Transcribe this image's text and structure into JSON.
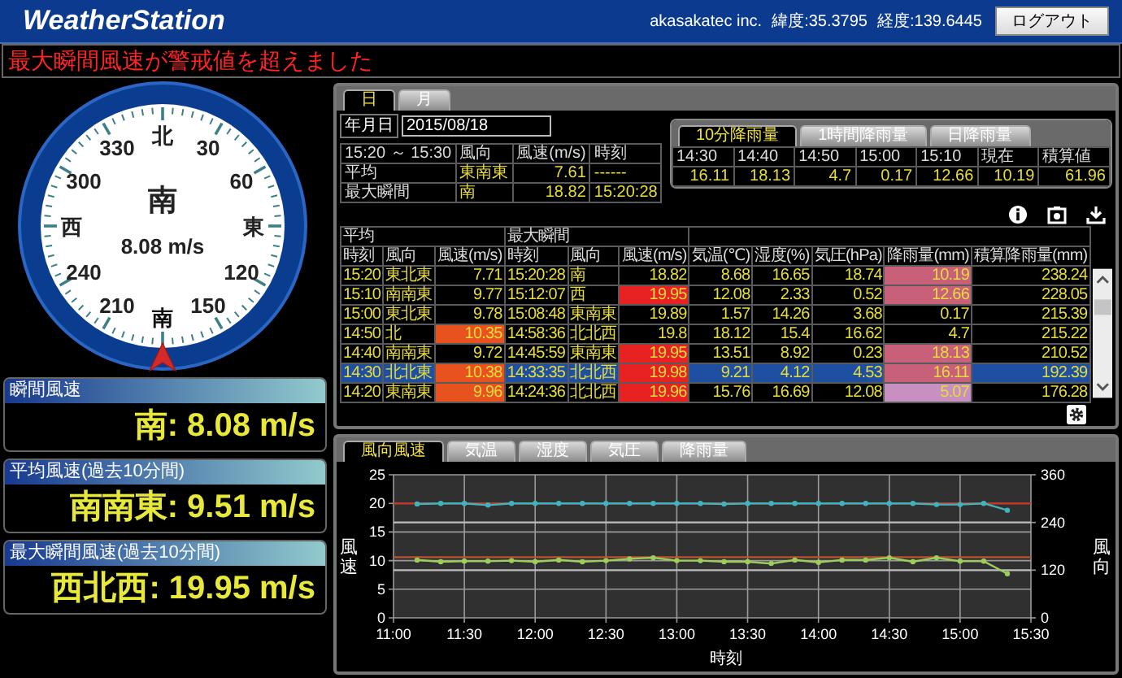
{
  "header": {
    "title": "WeatherStation",
    "company": "akasakatec inc.",
    "latitude": "緯度:35.3795",
    "longitude": "経度:139.6445",
    "logout_button": "ログアウト"
  },
  "alert": "最大瞬間風速が警戒値を超えました",
  "compass": {
    "dial_labels": [
      {
        "text": "北",
        "selected": false
      },
      {
        "text": "330",
        "selected": false
      },
      {
        "text": "30",
        "selected": false
      },
      {
        "text": "300",
        "selected": false
      },
      {
        "text": "60",
        "selected": false
      },
      {
        "text": "西",
        "selected": false
      },
      {
        "text": "東",
        "selected": false
      },
      {
        "text": "240",
        "selected": false
      },
      {
        "text": "120",
        "selected": false
      },
      {
        "text": "210",
        "selected": false
      },
      {
        "text": "150",
        "selected": false
      },
      {
        "text": "南",
        "selected": true
      }
    ],
    "direction": "南",
    "speed": "8.08 m/s"
  },
  "wind_panels": [
    {
      "title": "瞬間風速",
      "value": "南: 8.08 m/s"
    },
    {
      "title": "平均風速(過去10分間)",
      "value": "南南東: 9.51 m/s"
    },
    {
      "title": "最大瞬間風速(過去10分間)",
      "value": "西北西: 19.95 m/s"
    }
  ],
  "period_tabs": [
    {
      "label": "日",
      "selected": true
    },
    {
      "label": "月",
      "selected": false
    }
  ],
  "date": {
    "label": "年月日",
    "value": "2015/08/18"
  },
  "summary": {
    "columns": [
      "15:20 ～ 15:30",
      "風向",
      "風速(m/s)",
      "時刻"
    ],
    "rows": [
      [
        "平均",
        "東南東",
        "7.61",
        "------"
      ],
      [
        "最大瞬間",
        "南",
        "18.82",
        "15:20:28"
      ]
    ]
  },
  "rain": {
    "tabs": [
      {
        "label": "10分降雨量",
        "selected": true
      },
      {
        "label": "1時間降雨量",
        "selected": false
      },
      {
        "label": "日降雨量",
        "selected": false
      }
    ],
    "columns": [
      "14:30",
      "14:40",
      "14:50",
      "15:00",
      "15:10",
      "現在",
      "積算値"
    ],
    "values": [
      "16.11",
      "18.13",
      "4.7",
      "0.17",
      "12.66",
      "10.19",
      "61.96"
    ]
  },
  "table": {
    "groups": [
      {
        "label": "平均",
        "columns": [
          "時刻",
          "風向",
          "風速(m/s)"
        ]
      },
      {
        "label": "最大瞬間",
        "columns": [
          "時刻",
          "風向",
          "風速(m/s)"
        ]
      },
      {
        "columns": [
          "気温(℃)",
          "湿度(%)",
          "気圧(hPa)",
          "降雨量(mm)",
          "積算降雨量(mm)"
        ]
      }
    ],
    "rows": [
      {
        "selected": false,
        "cells": [
          {
            "text": "15:20"
          },
          {
            "text": "東北東"
          },
          {
            "text": "7.71"
          },
          {
            "text": "15:20:28"
          },
          {
            "text": "南"
          },
          {
            "text": "18.82"
          },
          {
            "text": "8.68"
          },
          {
            "text": "16.65"
          },
          {
            "text": "18.74"
          },
          {
            "text": "10.19",
            "color": "#c8607a"
          },
          {
            "text": "238.24"
          }
        ]
      },
      {
        "selected": false,
        "cells": [
          {
            "text": "15:10"
          },
          {
            "text": "南南東"
          },
          {
            "text": "9.77"
          },
          {
            "text": "15:12:07"
          },
          {
            "text": "西"
          },
          {
            "text": "19.95",
            "color": "#e82222"
          },
          {
            "text": "12.08"
          },
          {
            "text": "2.33"
          },
          {
            "text": "0.52"
          },
          {
            "text": "12.66",
            "color": "#c8607a"
          },
          {
            "text": "228.05"
          }
        ]
      },
      {
        "selected": false,
        "cells": [
          {
            "text": "15:00"
          },
          {
            "text": "東北東"
          },
          {
            "text": "9.78"
          },
          {
            "text": "15:08:48"
          },
          {
            "text": "東南東"
          },
          {
            "text": "19.89"
          },
          {
            "text": "1.57"
          },
          {
            "text": "14.26"
          },
          {
            "text": "3.68"
          },
          {
            "text": "0.17"
          },
          {
            "text": "215.39"
          }
        ]
      },
      {
        "selected": false,
        "cells": [
          {
            "text": "14:50"
          },
          {
            "text": "北"
          },
          {
            "text": "10.35",
            "color": "#e8521e"
          },
          {
            "text": "14:58:36"
          },
          {
            "text": "北北西"
          },
          {
            "text": "19.8"
          },
          {
            "text": "18.12"
          },
          {
            "text": "15.4"
          },
          {
            "text": "16.62"
          },
          {
            "text": "4.7"
          },
          {
            "text": "215.22"
          }
        ]
      },
      {
        "selected": false,
        "cells": [
          {
            "text": "14:40"
          },
          {
            "text": "南南東"
          },
          {
            "text": "9.72"
          },
          {
            "text": "14:45:59"
          },
          {
            "text": "東南東"
          },
          {
            "text": "19.95",
            "color": "#e82222"
          },
          {
            "text": "13.51"
          },
          {
            "text": "8.92"
          },
          {
            "text": "0.23"
          },
          {
            "text": "18.13",
            "color": "#c8607a"
          },
          {
            "text": "210.52"
          }
        ]
      },
      {
        "selected": true,
        "cells": [
          {
            "text": "14:30"
          },
          {
            "text": "北北東"
          },
          {
            "text": "10.38",
            "color": "#e8521e"
          },
          {
            "text": "14:33:35"
          },
          {
            "text": "北北西"
          },
          {
            "text": "19.98",
            "color": "#e82222"
          },
          {
            "text": "9.21"
          },
          {
            "text": "4.12"
          },
          {
            "text": "4.53"
          },
          {
            "text": "16.11",
            "color": "#c8607a"
          },
          {
            "text": "192.39"
          }
        ]
      },
      {
        "selected": false,
        "cells": [
          {
            "text": "14:20"
          },
          {
            "text": "東南東"
          },
          {
            "text": "9.96",
            "color": "#e8521e"
          },
          {
            "text": "14:24:36"
          },
          {
            "text": "北北西"
          },
          {
            "text": "19.96",
            "color": "#e82222"
          },
          {
            "text": "15.76"
          },
          {
            "text": "16.69"
          },
          {
            "text": "12.08"
          },
          {
            "text": "5.07",
            "color": "#c890c0"
          },
          {
            "text": "176.28"
          }
        ]
      }
    ]
  },
  "chart": {
    "tabs": [
      {
        "label": "風向風速",
        "selected": true
      },
      {
        "label": "気温",
        "selected": false
      },
      {
        "label": "湿度",
        "selected": false
      },
      {
        "label": "気圧",
        "selected": false
      },
      {
        "label": "降雨量",
        "selected": false
      }
    ],
    "chart_data": {
      "type": "line",
      "xlabel": "時刻",
      "ylabel": "風速",
      "x": [
        670,
        680,
        690,
        700,
        710,
        720,
        730,
        740,
        750,
        760,
        770,
        780,
        790,
        800,
        810,
        820,
        830,
        840,
        850,
        860,
        870,
        880,
        890,
        900,
        910,
        920
      ],
      "series": [
        {
          "color": "#40b4bc",
          "marker": "circle",
          "values": [
            19.9,
            20,
            20,
            19.7,
            20,
            20,
            20,
            20,
            20,
            20,
            20,
            20,
            20,
            19.9,
            20,
            20,
            20,
            20,
            20,
            20,
            20,
            20,
            19.8,
            19.8,
            20,
            18.8
          ]
        },
        {
          "color": "#9ccf5a",
          "marker": "circle",
          "values": [
            10.1,
            9.8,
            9.9,
            9.9,
            10,
            9.8,
            10.1,
            9.8,
            10,
            10.3,
            10.5,
            10,
            10,
            9.8,
            9.8,
            9.5,
            10.1,
            9.7,
            10.1,
            10.1,
            10.5,
            9.8,
            10.5,
            9.9,
            9.9,
            7.7
          ]
        }
      ],
      "xlim": [
        660,
        930
      ],
      "ylim": [
        0,
        25
      ],
      "xticks": [
        {
          "value": 660,
          "label": "11:00"
        },
        {
          "value": 690,
          "label": "11:30"
        },
        {
          "value": 720,
          "label": "12:00"
        },
        {
          "value": 750,
          "label": "12:30"
        },
        {
          "value": 780,
          "label": "13:00"
        },
        {
          "value": 810,
          "label": "13:30"
        },
        {
          "value": 840,
          "label": "14:00"
        },
        {
          "value": 870,
          "label": "14:30"
        },
        {
          "value": 900,
          "label": "15:00"
        },
        {
          "value": 930,
          "label": "15:30"
        }
      ],
      "yticks": [
        0,
        5,
        10,
        15,
        20,
        25
      ],
      "grid": true,
      "ref_lines": [
        {
          "axis": "y",
          "value": 20,
          "color": "#c0392b"
        },
        {
          "axis": "y",
          "value": 10.6,
          "color": "#b8552e"
        },
        {
          "axis": "y",
          "value": 16.67,
          "color": "#bdbdbd"
        },
        {
          "axis": "y",
          "value": 8.33,
          "color": "#bdbdbd"
        }
      ]
    },
    "right_axis": {
      "label": "風向",
      "ticks": [
        "360",
        "240",
        "120",
        "0"
      ]
    }
  }
}
